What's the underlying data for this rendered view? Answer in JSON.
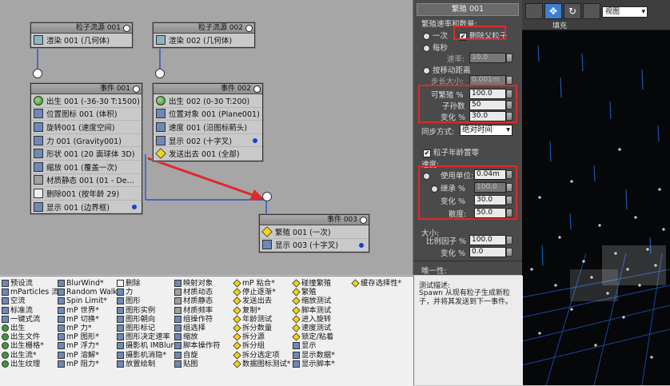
{
  "nodes": {
    "src1": {
      "title": "粒子流源 001",
      "row": "渲染 001 (几何体)"
    },
    "src2": {
      "title": "粒子流源 002",
      "row": "渲染 002 (几何体)"
    },
    "ev1": {
      "title": "事件 001",
      "rows": [
        "出生 001 (-36-30 T:1500)",
        "位置图标 001 (体积)",
        "旋转001 (速度空间)",
        "力 001 (Gravity001)",
        "形状 001 (20 面球体 3D)",
        "缩放 001 (覆盖一次)",
        "材质静态 001 (01 - De...",
        "删除001 (按年龄 29)",
        "显示 001 (边界框)"
      ]
    },
    "ev2": {
      "title": "事件 002",
      "rows": [
        "出生 002 (0-30 T:200)",
        "位置对象 001 (Plane001)",
        "速度 001 (沿图标箭头)",
        "显示 002 (十字叉)",
        "发送出去 001 (全部)"
      ]
    },
    "ev3": {
      "title": "事件 003",
      "rows": [
        "繁殖 001 (一次)",
        "显示 003 (十字叉)"
      ]
    }
  },
  "panel": {
    "title": "繁殖 001",
    "rate_group": "繁殖速率和数量:",
    "once": "一次",
    "delete_parent": "删除父粒子",
    "per_second": "每秒",
    "rate_label": "速率:",
    "rate_value": "10.0",
    "by_distance": "按移动距离",
    "step_label": "步长大小:",
    "step_value": "0.001m",
    "spawnable_label": "可繁殖 %",
    "spawnable_value": "100.0",
    "offspring_label": "子孙数",
    "offspring_value": "50",
    "variation_label": "变化 %",
    "variation_value": "30.0",
    "sync_label": "同步方式:",
    "sync_value": "绝对时间",
    "age_reset": "粒子年龄置零",
    "speed_group": "速度:",
    "use_units": "使用单位:",
    "use_units_value": "0.04m",
    "inherit_label": "继承 %",
    "inherit_value": "100.0",
    "speed_var_label": "变化 %",
    "speed_var_value": "30.0",
    "divergence_label": "散度:",
    "divergence_value": "50.0",
    "size_group": "大小:",
    "scale_label": "比例因子 %",
    "scale_value": "100.0",
    "size_var_label": "变化 %",
    "size_var_value": "0.0",
    "uniqueness": "唯一性:"
  },
  "viewport": {
    "view_label": "视图",
    "fill_label": "填充"
  },
  "depot": {
    "col1": [
      "预设流",
      "mParticles 流*",
      "空流",
      "标准流",
      "一键式流",
      "出生",
      "出生文件",
      "出生栅格*",
      "出生流*",
      "出生纹理"
    ],
    "col2": [
      "BlurWind*",
      "Random Walk*",
      "Spin Limit*",
      "mP 世界*",
      "mP 切换*",
      "mP 力*",
      "mP 图形*",
      "mP 浮力*",
      "mP 溶解*",
      "mP 阻力*"
    ],
    "col3": [
      "删除",
      "力",
      "图形",
      "图形实例",
      "图形朝向",
      "图形标记",
      "图形决定速率",
      "摄影机 IMBlur*",
      "摄影机消隐*",
      "放置绘制"
    ],
    "col4": [
      "映射对象",
      "材质动态",
      "材质静态",
      "材质频率",
      "组操作符",
      "组选择",
      "缩放",
      "脚本操作符",
      "自旋",
      "贴图"
    ],
    "col5": [
      "mP 粘合*",
      "停止逐渐*",
      "发送出去",
      "复制*",
      "年龄测试",
      "拆分数量",
      "拆分源",
      "拆分组",
      "拆分选定项",
      "数据图标测试*"
    ],
    "col6": [
      "碰撞繁殖",
      "繁殖",
      "缩放测试",
      "脚本测试",
      "进入旋转",
      "速度测试",
      "锁定/粘着",
      "显示",
      "显示数据*",
      "显示脚本*"
    ],
    "col7": [
      "缓存选择性*"
    ]
  },
  "description": {
    "label": "测试描述:",
    "text": "Spawn 从现有粒子生成新粒子，并将其发送到下一事件。"
  },
  "colors": {
    "highlight": "#e0282d",
    "connector": "#1b3fcf"
  }
}
